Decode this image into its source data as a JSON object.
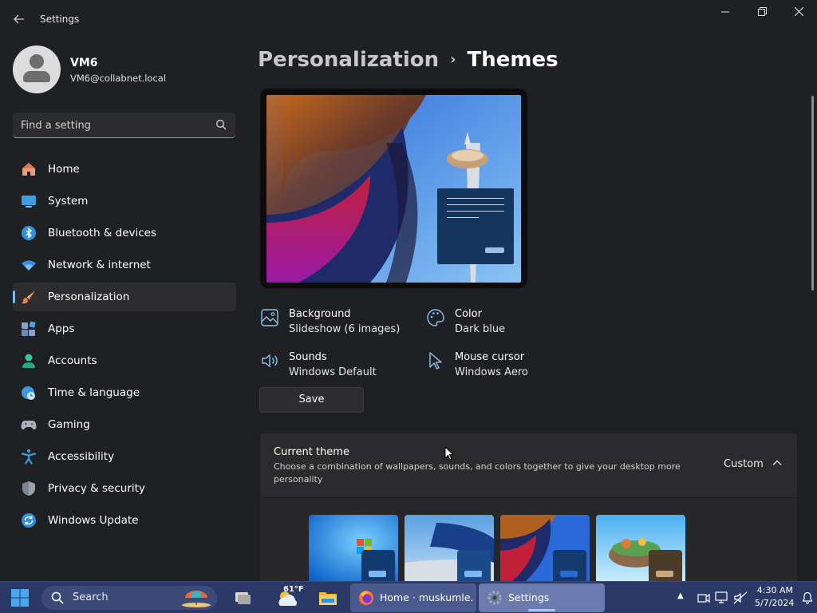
{
  "window": {
    "title": "Settings",
    "back_icon": "arrow-left-icon",
    "controls": {
      "minimize": "—",
      "maximize": "❐",
      "close": "✕"
    }
  },
  "profile": {
    "name": "VM6",
    "email": "VM6@collabnet.local"
  },
  "search": {
    "placeholder": "Find a setting",
    "icon": "search-icon"
  },
  "sidebar": {
    "items": [
      {
        "label": "Home",
        "icon": "home-icon",
        "active": false
      },
      {
        "label": "System",
        "icon": "monitor-icon",
        "active": false
      },
      {
        "label": "Bluetooth & devices",
        "icon": "bluetooth-icon",
        "active": false
      },
      {
        "label": "Network & internet",
        "icon": "wifi-icon",
        "active": false
      },
      {
        "label": "Personalization",
        "icon": "paintbrush-icon",
        "active": true
      },
      {
        "label": "Apps",
        "icon": "apps-icon",
        "active": false
      },
      {
        "label": "Accounts",
        "icon": "person-icon",
        "active": false
      },
      {
        "label": "Time & language",
        "icon": "globe-clock-icon",
        "active": false
      },
      {
        "label": "Gaming",
        "icon": "gamepad-icon",
        "active": false
      },
      {
        "label": "Accessibility",
        "icon": "accessibility-icon",
        "active": false
      },
      {
        "label": "Privacy & security",
        "icon": "shield-icon",
        "active": false
      },
      {
        "label": "Windows Update",
        "icon": "update-icon",
        "active": false
      }
    ]
  },
  "breadcrumb": {
    "parent": "Personalization",
    "separator": "›",
    "current": "Themes"
  },
  "properties": {
    "background": {
      "title": "Background",
      "value": "Slideshow (6 images)",
      "icon": "image-icon"
    },
    "color": {
      "title": "Color",
      "value": "Dark blue",
      "icon": "palette-icon"
    },
    "sounds": {
      "title": "Sounds",
      "value": "Windows Default",
      "icon": "speaker-icon"
    },
    "cursor": {
      "title": "Mouse cursor",
      "value": "Windows Aero",
      "icon": "cursor-icon"
    }
  },
  "save_label": "Save",
  "current_theme": {
    "title": "Current theme",
    "description": "Choose a combination of wallpapers, sounds, and colors together to give your desktop more personality",
    "value": "Custom",
    "expanded": true
  },
  "theme_thumbnails": [
    {
      "name": "windows-7-theme"
    },
    {
      "name": "airplane-theme"
    },
    {
      "name": "abstract-building-theme"
    },
    {
      "name": "floating-island-theme"
    }
  ],
  "taskbar": {
    "search_label": "Search",
    "weather_temp": "61°F",
    "apps": [
      {
        "label": "Home · muskumle...",
        "icon": "firefox-icon"
      },
      {
        "label": "Settings",
        "icon": "settings-gear-icon"
      }
    ],
    "time": "4:30 AM",
    "date": "5/7/2024"
  },
  "colors": {
    "window_bg": "#1f2023",
    "accent": "#76b9ed",
    "taskbar": "#2b3966"
  }
}
